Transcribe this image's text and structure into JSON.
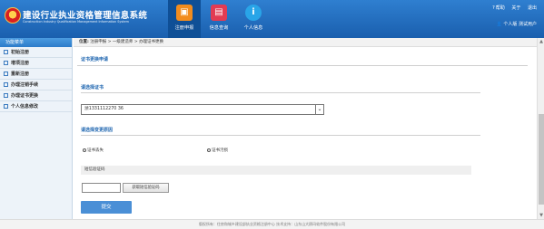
{
  "header": {
    "title": "建设行业执业资格管理信息系统",
    "subtitle": "Construction Industry Qualification Management Information System",
    "nav": [
      {
        "label": "注册申报",
        "icon": "register-icon",
        "color": "#f28c1e"
      },
      {
        "label": "信息查询",
        "icon": "query-icon",
        "color": "#e23b53"
      },
      {
        "label": "个人信息",
        "icon": "info-icon",
        "color": "#29a5e8"
      }
    ],
    "help": "帮助",
    "about": "关于",
    "logout": "退出",
    "user_label": "个人版 测试用户"
  },
  "sidebar": {
    "heading": "功能菜单",
    "items": [
      {
        "label": "初始注册"
      },
      {
        "label": "增项注册"
      },
      {
        "label": "重新注册"
      },
      {
        "label": "办理注销手续"
      },
      {
        "label": "办理证书更换"
      },
      {
        "label": "个人信息修改"
      }
    ]
  },
  "breadcrumb": {
    "prefix": "位置:",
    "items": [
      "注册申报",
      ">",
      "一级建造师",
      ">",
      "办理证书更换"
    ]
  },
  "form": {
    "section_title": "证书更换申请",
    "cert_label": "请选择证书",
    "cert_value": "浙1331112270 36",
    "reason_label": "请选择变更原因",
    "radio1": "证书丢失",
    "radio2": "证书污损",
    "sms_label": "短信验证码",
    "get_code": "获取短信验证码",
    "submit": "提交"
  },
  "footer": "版权所有：住房和城乡建设部执业资格注册中心    技术支持：山东山大鸥玛软件股份有限公司"
}
